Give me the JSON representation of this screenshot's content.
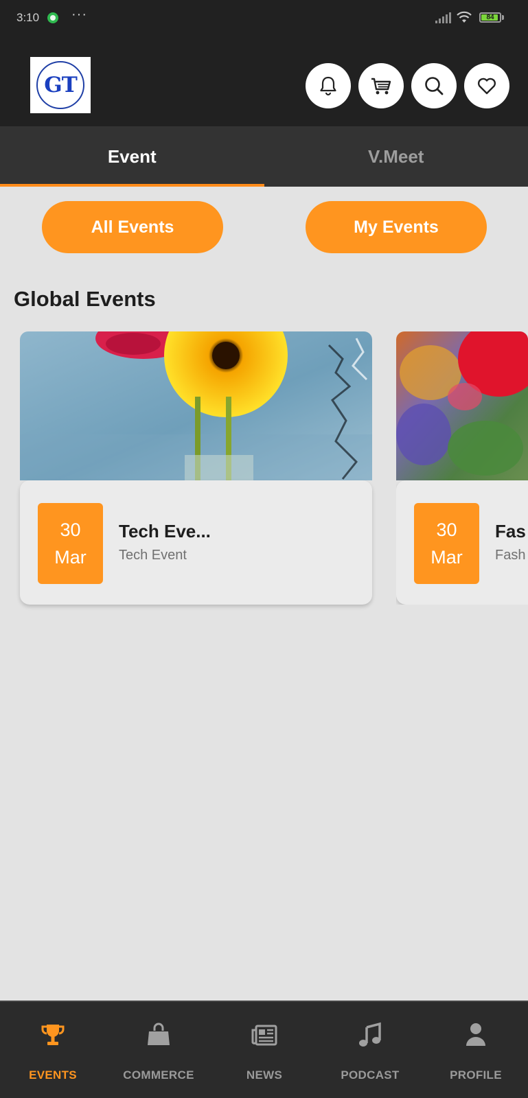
{
  "status_bar": {
    "time": "3:10",
    "dots": "···",
    "battery": "84",
    "battery_level": 0.84
  },
  "header": {
    "logo_text": "GT",
    "icons": [
      "bell-icon",
      "cart-icon",
      "search-icon",
      "heart-icon"
    ]
  },
  "tabs": [
    {
      "label": "Event",
      "active": true
    },
    {
      "label": "V.Meet",
      "active": false
    }
  ],
  "filters": {
    "all_events": "All Events",
    "my_events": "My Events"
  },
  "section_title": "Global Events",
  "events": [
    {
      "day": "30",
      "month": "Mar",
      "title": "Tech Eve...",
      "subtitle": "Tech Event"
    },
    {
      "day": "30",
      "month": "Mar",
      "title": "Fas",
      "subtitle": "Fash"
    }
  ],
  "bottom_nav": [
    {
      "label": "EVENTS",
      "icon": "trophy-icon",
      "active": true
    },
    {
      "label": "COMMERCE",
      "icon": "shopping-bag-icon",
      "active": false
    },
    {
      "label": "NEWS",
      "icon": "newspaper-icon",
      "active": false
    },
    {
      "label": "PODCAST",
      "icon": "music-note-icon",
      "active": false
    },
    {
      "label": "PROFILE",
      "icon": "user-icon",
      "active": false
    }
  ],
  "colors": {
    "accent": "#ff951f",
    "header_bg": "#212121",
    "tab_bg": "#333333",
    "page_bg": "#e3e3e3",
    "nav_bg": "#2b2b2b"
  }
}
